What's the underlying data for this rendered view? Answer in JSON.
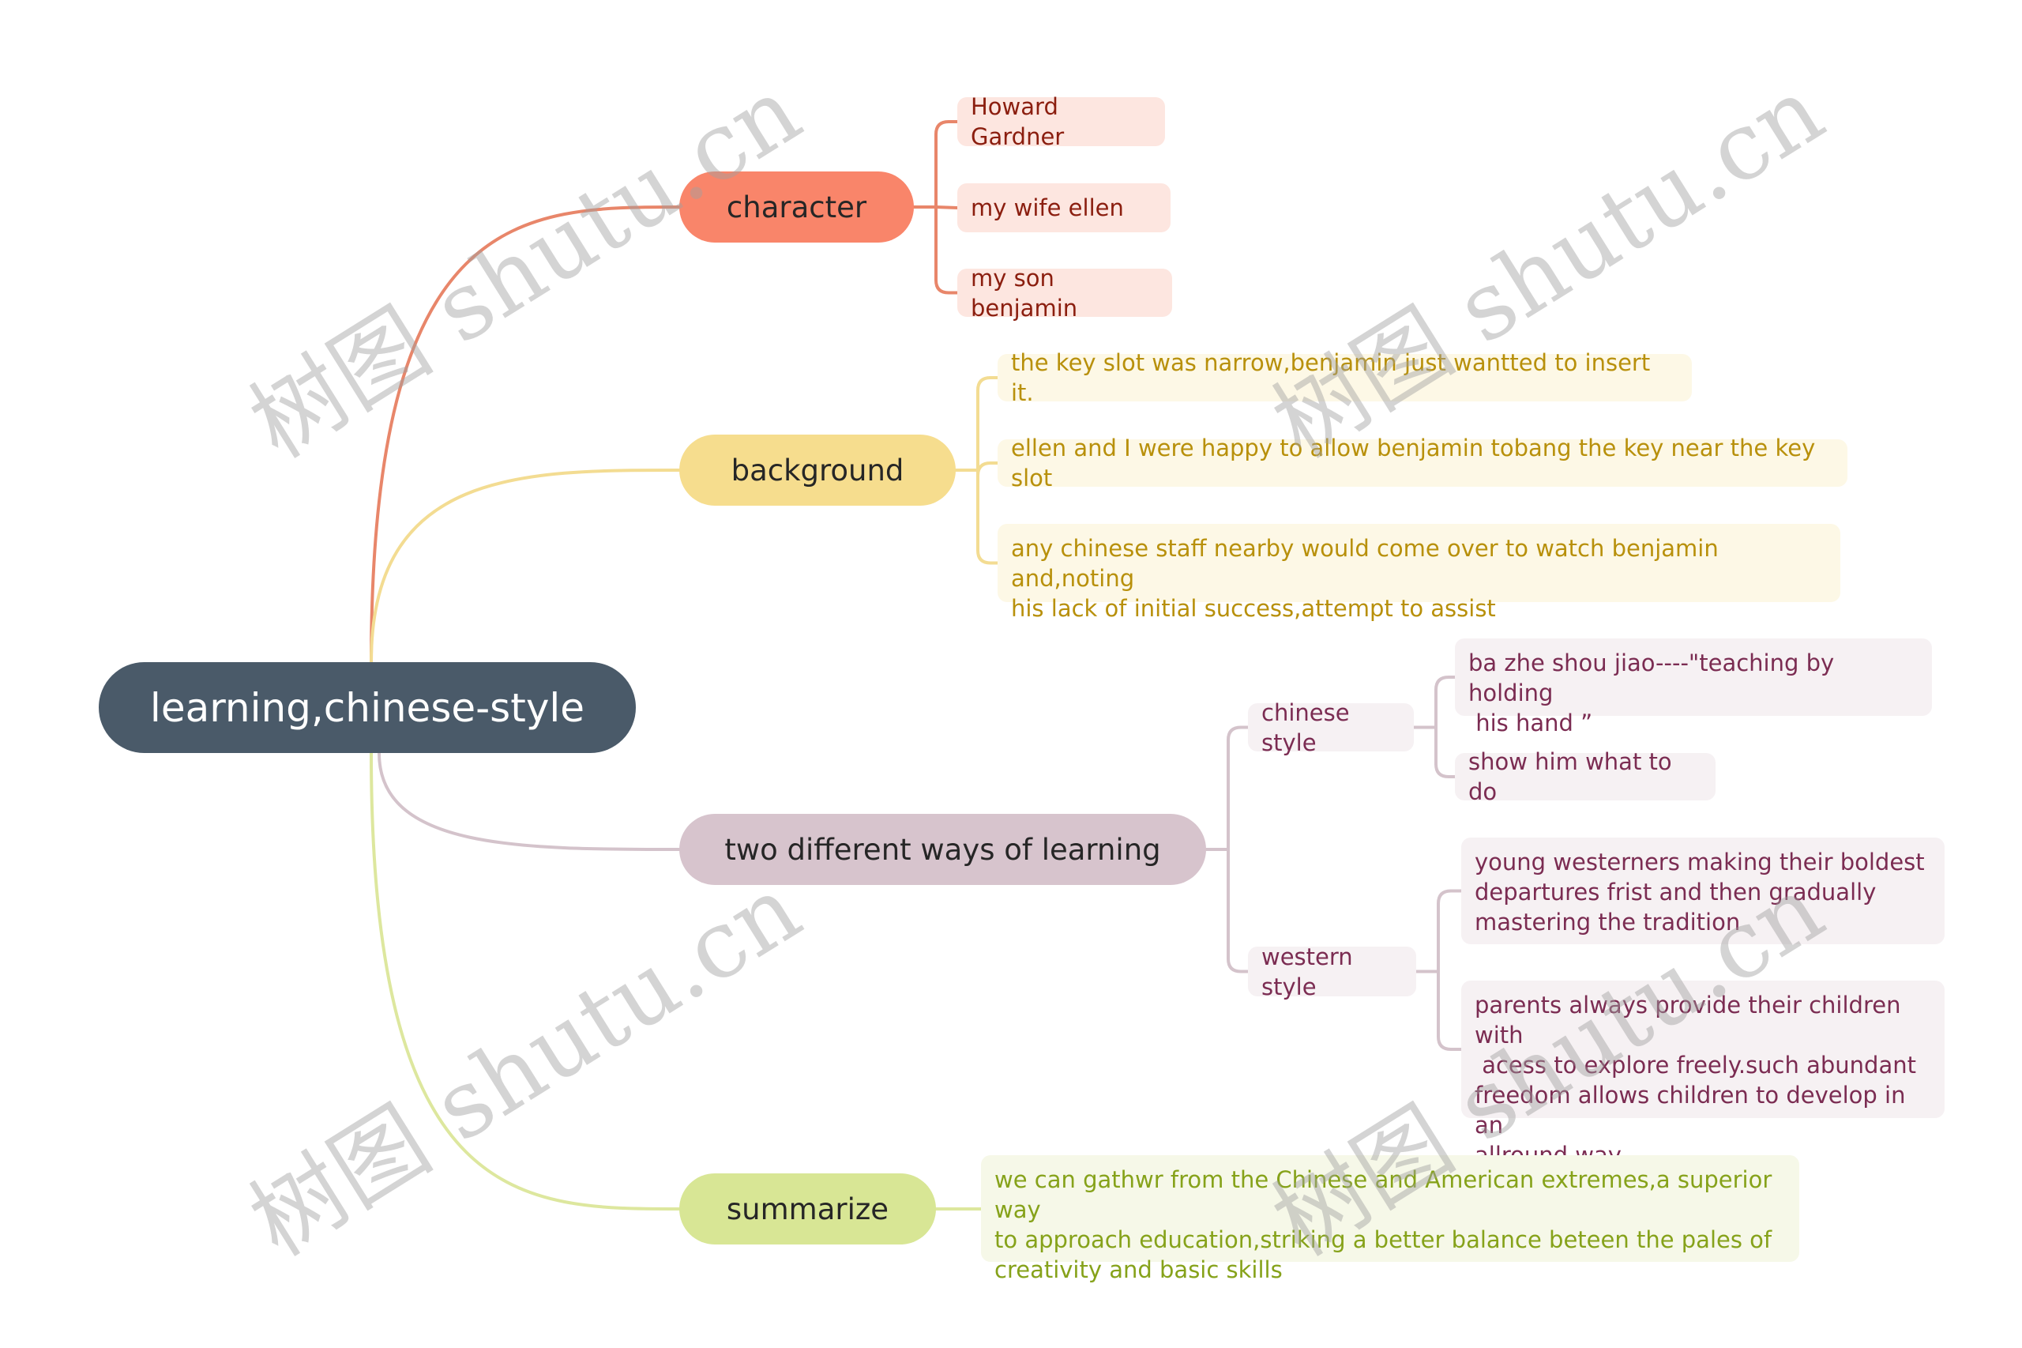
{
  "root": {
    "label": "learning,chinese-style",
    "color": "#4a5a69"
  },
  "branches": [
    {
      "label": "character",
      "color": "#f9856a",
      "line_color": "#e8866a",
      "leaf_bg": "#fde6e0",
      "leaf_text": "#8b1e0f",
      "children": [
        "Howard Gardner",
        "my wife ellen",
        "my son benjamin"
      ]
    },
    {
      "label": "background",
      "color": "#f6dd8e",
      "line_color": "#f3dc92",
      "leaf_bg": "#fdf8e6",
      "leaf_text": "#b8900b",
      "children": [
        "the key slot was narrow,benjamin just wantted to insert it.",
        "ellen and I were happy to allow benjamin tobang the key near the key slot",
        "any chinese staff nearby would come over to watch benjamin and,noting\nhis lack of initial success,attempt to assist"
      ]
    },
    {
      "label": "two different ways of learning",
      "color": "#d7c4cd",
      "line_color": "#d4c3cb",
      "leaf_bg": "#f6f1f3",
      "leaf_text": "#7b2c52",
      "children": [
        {
          "label": "chinese style",
          "children": [
            "ba zhe shou jiao----\"teaching by holding\n his hand ”",
            "show him what to do"
          ]
        },
        {
          "label": "western style",
          "children": [
            "young westerners making their boldest\ndepartures frist and then gradually\nmastering the tradition",
            "parents always provide their children with\n acess to explore freely.such abundant\nfreedom allows children to develop in an\nallround way."
          ]
        }
      ]
    },
    {
      "label": "summarize",
      "color": "#d8e695",
      "line_color": "#dde79e",
      "leaf_bg": "#f6f8e8",
      "leaf_text": "#86a21a",
      "children": [
        "we can gathwr from the Chinese and American extremes,a superior way\nto approach education,striking a better balance beteen the pales of\ncreativity and basic skills"
      ]
    }
  ],
  "watermark": "树图 shutu.cn"
}
